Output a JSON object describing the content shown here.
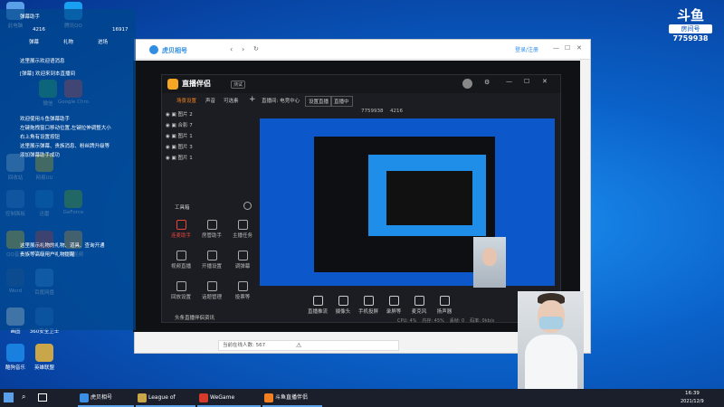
{
  "room": {
    "brand": "斗鱼",
    "sub": "房间号",
    "number": "7759938"
  },
  "desktop_icons": [
    {
      "label": "此电脑",
      "color": "#5aa0e8"
    },
    {
      "label": "腾讯QQ",
      "color": "#1aa0f0"
    },
    {
      "label": "微信",
      "color": "#2bb24c"
    },
    {
      "label": "Google Chrome",
      "color": "#e94235"
    },
    {
      "label": "回收站",
      "color": "#8fb7e0"
    },
    {
      "label": "网易UU",
      "color": "#f0c000"
    },
    {
      "label": "控制面板",
      "color": "#3a7bd5"
    },
    {
      "label": "迅雷",
      "color": "#1a7bd5"
    },
    {
      "label": "GeForce",
      "color": "#76b900"
    },
    {
      "label": "QQ音乐",
      "color": "#f5c400"
    },
    {
      "label": "WeGame",
      "color": "#d63a2a"
    },
    {
      "label": "腾讯视频",
      "color": "#f0a020"
    },
    {
      "label": "Word",
      "color": "#2b5797"
    },
    {
      "label": "百度网盘",
      "color": "#3a8ee6"
    },
    {
      "label": "画图",
      "color": "#e8e8e8"
    },
    {
      "label": "360安全卫士",
      "color": "#2a6fd0"
    },
    {
      "label": "酷狗音乐",
      "color": "#1a80e0"
    },
    {
      "label": "英雄联盟",
      "color": "#c9a64a"
    }
  ],
  "chat": {
    "title": "弹幕助手",
    "stats": [
      "4216",
      "16917"
    ],
    "tabs": [
      "弹幕",
      "礼物",
      "进场"
    ],
    "lines": [
      "这里展示欢迎语消息",
      "[弹幕] 欢迎来到本直播间",
      "欢迎使用斗鱼弹幕助手",
      "左键拖拽窗口移动位置,左键拉伸调整大小",
      "右上角有设置按钮",
      "这里展示弹幕、贵族消息、粉丝牌升级等",
      "添加弹幕助手成功",
      "这里展示礼物的礼物、道具、查询开通",
      "贵族等高级用户礼物提醒"
    ]
  },
  "browser": {
    "title": "虎贝相号",
    "login": "登录/注册",
    "online_label": "当前在线人数: 567"
  },
  "companion": {
    "title": "直播伴侣",
    "badge": "测试",
    "tabs": [
      "场景设置",
      "声音",
      "可选素"
    ],
    "scenes": [
      "图片 2",
      "合影 7",
      "图片 1",
      "图片 3",
      "图片 1"
    ],
    "toolbox_label": "工具箱",
    "tools": [
      "连麦助手",
      "房管助手",
      "主播任务",
      "视频直播",
      "开播设置",
      "调弹幕",
      "回放设置",
      "话题管理",
      "投票等"
    ],
    "bottom_label": "头条直播伴侣资讯",
    "room_label": "直播间: 电竞中心",
    "room_id": "7759938",
    "online": "4216",
    "actions": [
      "设置直播",
      "直播中"
    ],
    "bottom_tools": [
      "直播推流",
      "摄像头",
      "手机投屏",
      "录屏等",
      "麦克风",
      "扬声器"
    ],
    "status_items": [
      "CPU: 4%",
      "内存: 45%",
      "丢帧: 0",
      "码率: 0kb/s"
    ]
  },
  "taskbar": {
    "apps": [
      {
        "label": "虎贝相号",
        "color": "#3a8ee6"
      },
      {
        "label": "League of Legends",
        "color": "#c9a64a"
      },
      {
        "label": "WeGame",
        "color": "#d63a2a"
      },
      {
        "label": "斗鱼直播伴侣",
        "color": "#f08020"
      }
    ],
    "time": "16:39",
    "date": "2021/12/9"
  }
}
